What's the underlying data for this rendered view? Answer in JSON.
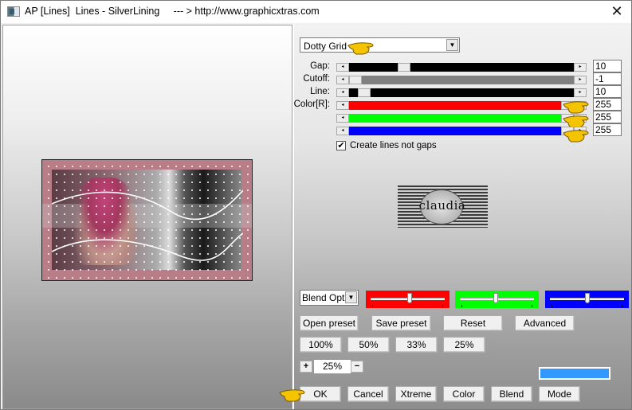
{
  "window": {
    "title": "AP [Lines]  Lines - SilverLining     --- > http://www.graphicxtras.com",
    "close_icon": "close-x-icon"
  },
  "preset_select": {
    "value": "Dotty Grid"
  },
  "params": [
    {
      "label": "Gap:",
      "value": "10",
      "track_color": "#000000",
      "thumb_position": 0.23
    },
    {
      "label": "Cutoff:",
      "value": "-1",
      "track_color": "#808080",
      "thumb_position": 0.0
    },
    {
      "label": "Line:",
      "value": "10",
      "track_color": "#000000",
      "thumb_position": 0.04
    },
    {
      "label": "Color[R]:",
      "value": "255",
      "track_color": "#ff0000",
      "thumb_position": 1.0
    },
    {
      "label": "",
      "value": "255",
      "track_color": "#00ff00",
      "thumb_position": 1.0
    },
    {
      "label": "",
      "value": "255",
      "track_color": "#0000ff",
      "thumb_position": 1.0
    }
  ],
  "create_lines": {
    "label": "Create lines not gaps",
    "checked": true
  },
  "logo": {
    "text": "claudia"
  },
  "blend_select": {
    "value": "Blend Opti"
  },
  "blend_sliders": [
    {
      "name": "red",
      "color": "#ff0000",
      "position": 0.53
    },
    {
      "name": "green",
      "color": "#00ff00",
      "position": 0.48
    },
    {
      "name": "blue",
      "color": "#0000ff",
      "position": 0.51
    }
  ],
  "preset_buttons": {
    "open": "Open preset",
    "save": "Save preset",
    "reset": "Reset",
    "advanced": "Advanced"
  },
  "zoom_buttons": [
    "100%",
    "50%",
    "33%",
    "25%"
  ],
  "zoom_control": {
    "plus": "+",
    "value": "25%",
    "minus": "−"
  },
  "swatch_color": "#3399ff",
  "bottom_buttons": {
    "ok": "OK",
    "cancel": "Cancel",
    "xtreme": "Xtreme",
    "color": "Color",
    "blend": "Blend",
    "mode": "Mode"
  },
  "colors": {
    "hand_pointer": "#f5c400"
  }
}
